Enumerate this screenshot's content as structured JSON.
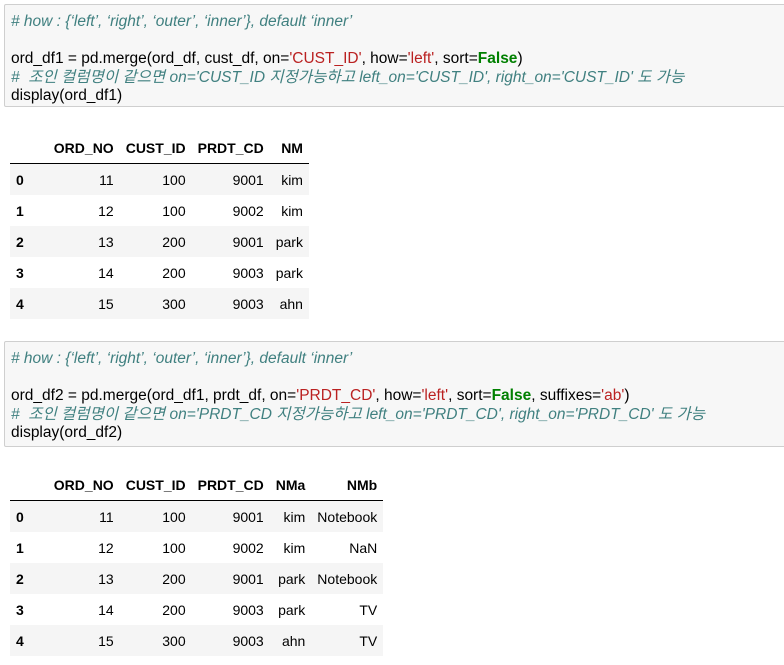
{
  "cell1": {
    "comment_how": "# how : {‘left’, ‘right’, ‘outer’, ‘inner’}, default ‘inner’",
    "code_a": "ord_df1 = pd.merge(ord_df, cust_df, on=",
    "str_on": "'CUST_ID'",
    "code_b": ", how=",
    "str_how": "'left'",
    "code_c": ", sort=",
    "kw_false": "False",
    "code_d": ")",
    "comment_note": "#  조인 컬럼명이 같으면 on='CUST_ID 지정가능하고 left_on='CUST_ID', right_on='CUST_ID' 도 가능",
    "display": "display(ord_df1)"
  },
  "table1": {
    "columns": [
      "",
      "ORD_NO",
      "CUST_ID",
      "PRDT_CD",
      "NM"
    ],
    "rows": [
      [
        "0",
        "11",
        "100",
        "9001",
        "kim"
      ],
      [
        "1",
        "12",
        "100",
        "9002",
        "kim"
      ],
      [
        "2",
        "13",
        "200",
        "9001",
        "park"
      ],
      [
        "3",
        "14",
        "200",
        "9003",
        "park"
      ],
      [
        "4",
        "15",
        "300",
        "9003",
        "ahn"
      ]
    ]
  },
  "cell2": {
    "comment_how": "# how : {‘left’, ‘right’, ‘outer’, ‘inner’}, default ‘inner’",
    "code_a": "ord_df2 = pd.merge(ord_df1, prdt_df, on=",
    "str_on": "'PRDT_CD'",
    "code_b": ", how=",
    "str_how": "'left'",
    "code_c": ", sort=",
    "kw_false": "False",
    "code_d": ", suffixes=",
    "str_suffix": "'ab'",
    "code_e": ")",
    "comment_note": "#  조인 컬럼명이 같으면 on='PRDT_CD 지정가능하고 left_on='PRDT_CD', right_on='PRDT_CD' 도 가능",
    "display": "display(ord_df2)"
  },
  "table2": {
    "columns": [
      "",
      "ORD_NO",
      "CUST_ID",
      "PRDT_CD",
      "NMa",
      "NMb"
    ],
    "rows": [
      [
        "0",
        "11",
        "100",
        "9001",
        "kim",
        "Notebook"
      ],
      [
        "1",
        "12",
        "100",
        "9002",
        "kim",
        "NaN"
      ],
      [
        "2",
        "13",
        "200",
        "9001",
        "park",
        "Notebook"
      ],
      [
        "3",
        "14",
        "200",
        "9003",
        "park",
        "TV"
      ],
      [
        "4",
        "15",
        "300",
        "9003",
        "ahn",
        "TV"
      ]
    ]
  }
}
